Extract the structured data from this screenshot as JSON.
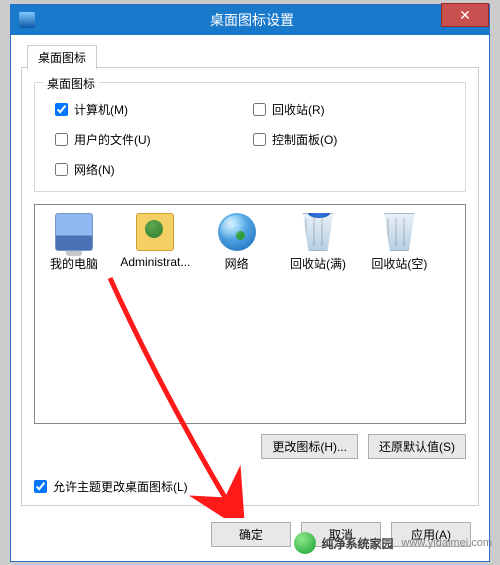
{
  "titlebar": {
    "title": "桌面图标设置",
    "close": "✕"
  },
  "tab": {
    "label": "桌面图标"
  },
  "group": {
    "legend": "桌面图标",
    "cbs": {
      "computer": {
        "label": "计算机(M)",
        "checked": true
      },
      "recycle": {
        "label": "回收站(R)",
        "checked": false
      },
      "userfiles": {
        "label": "用户的文件(U)",
        "checked": false
      },
      "control": {
        "label": "控制面板(O)",
        "checked": false
      },
      "network": {
        "label": "网络(N)",
        "checked": false
      }
    }
  },
  "icons": {
    "computer": "我的电脑",
    "admin": "Administrat...",
    "network": "网络",
    "recycleFull": "回收站(满)",
    "recycleEmpty": "回收站(空)"
  },
  "buttons": {
    "changeIcon": "更改图标(H)...",
    "restore": "还原默认值(S)",
    "ok": "确定",
    "cancel": "取消",
    "apply": "应用(A)"
  },
  "allowTheme": {
    "label": "允许主题更改桌面图标(L)",
    "checked": true
  },
  "watermark": {
    "cn": "纯净系统家园",
    "url": "www.yidaimei.com"
  }
}
